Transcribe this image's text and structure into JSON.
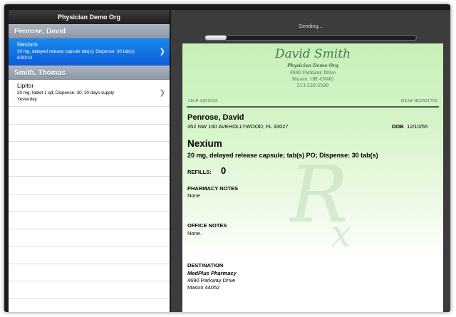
{
  "left_pane": {
    "title": "Physician Demo Org",
    "groups": [
      {
        "name": "Penrose, David",
        "items": [
          {
            "title": "Nexium",
            "detail": "20 mg, delayed release capsule tab(s); Dispense: 30 tab(s)",
            "date": "8/30/10",
            "selected": true
          }
        ]
      },
      {
        "name": "Smith, Thomas",
        "items": [
          {
            "title": "Lipitor",
            "detail": "20 mg, tablet 1 qd; Dispense: 30; 30 days supply",
            "date": "Yesterday",
            "selected": false
          }
        ]
      }
    ]
  },
  "right_pane": {
    "status": "Sending...",
    "progress": 0.1,
    "colors": {
      "paper_top": "#c6f0b6",
      "selected_row": "#0c5fd9",
      "section_header": "#8e99a8"
    },
    "prescription": {
      "doctor": "David Smith",
      "org": "Physician Demo Org",
      "address1": "4690 Parkway Drive",
      "address2": "Mason, OH 45040",
      "phone": "513-229-5500",
      "lic": "LIC# AS55555",
      "dea": "DEA# BE5521705",
      "patient_name": "Penrose, David",
      "patient_address": "352 NW 160 AVEHOLLYWOOD, FL 33027",
      "dob_label": "DOB",
      "dob": "12/10/55",
      "drug": "Nexium",
      "sig": "20 mg, delayed release capsule; tab(s) PO; Dispense: 30 tab(s)",
      "refills_label": "REFILLS:",
      "refills": "0",
      "pharmacy_notes_label": "PHARMACY NOTES",
      "pharmacy_notes": "None",
      "office_notes_label": "OFFICE NOTES",
      "office_notes": "None.",
      "destination_label": "DESTINATION",
      "pharmacy_name": "MedPlus Pharmacy",
      "pharmacy_address1": "4690 Parkway Drive",
      "pharmacy_address2": "Mason 44052"
    }
  }
}
